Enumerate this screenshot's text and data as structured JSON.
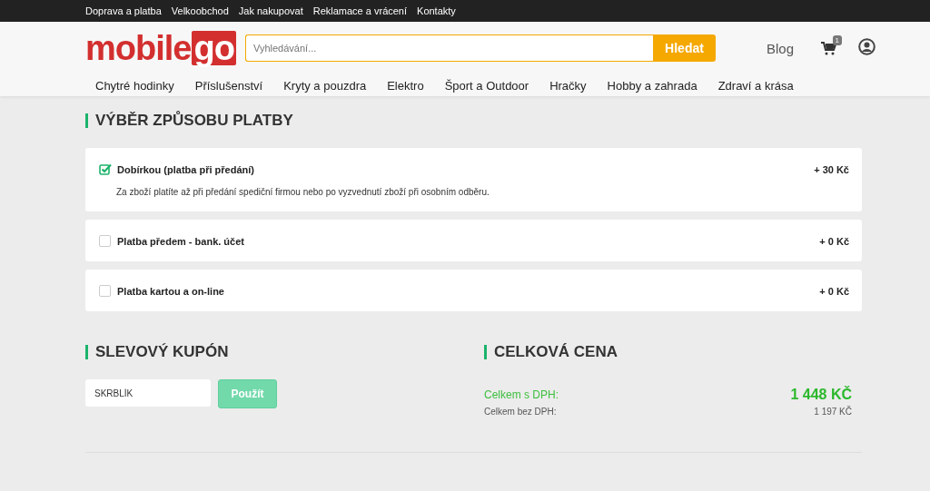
{
  "top_links": [
    "Doprava a platba",
    "Velkoobchod",
    "Jak nakupovat",
    "Reklamace a vrácení",
    "Kontakty"
  ],
  "logo": {
    "text": "mobile",
    "badge": "go"
  },
  "search": {
    "placeholder": "Vyhledávání...",
    "button": "Hledat"
  },
  "header_links": {
    "blog": "Blog",
    "cart_count": "1"
  },
  "categories": [
    "Chytré hodinky",
    "Příslušenství",
    "Kryty a pouzdra",
    "Elektro",
    "Šport a Outdoor",
    "Hračky",
    "Hobby a zahrada",
    "Zdraví a krása"
  ],
  "payment": {
    "title": "VÝBĚR ZPŮSOBU PLATBY",
    "options": [
      {
        "label": "Dobírkou (platba při předání)",
        "price": "+ 30 Kč",
        "selected": true,
        "description": "Za zboží platíte až při předání spediční firmou nebo po vyzvednutí zboží při osobním odběru."
      },
      {
        "label": "Platba předem - bank. účet",
        "price": "+ 0 Kč",
        "selected": false
      },
      {
        "label": "Platba kartou a on-line",
        "price": "+ 0 Kč",
        "selected": false
      }
    ]
  },
  "coupon": {
    "title": "SLEVOVÝ KUPÓN",
    "value": "SKRBLÍK",
    "button": "Použít"
  },
  "total": {
    "title": "CELKOVÁ CENA",
    "with_vat_label": "Celkem s DPH:",
    "with_vat": "1 448 KČ",
    "without_vat_label": "Celkem bez DPH:",
    "without_vat": "1 197 KČ"
  }
}
